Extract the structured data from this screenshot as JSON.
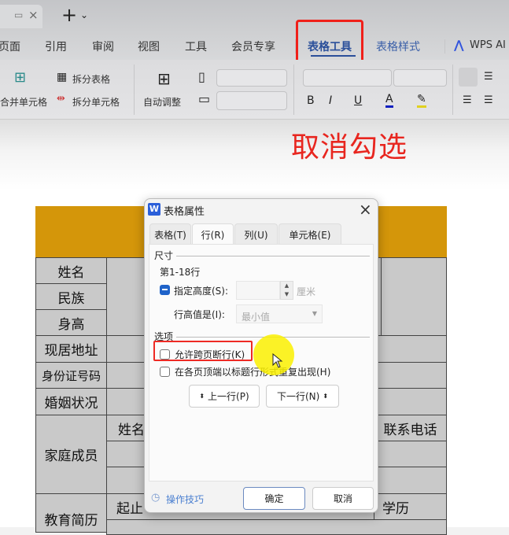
{
  "tabbar": {
    "new_tab": "+",
    "dropdown": "⌄"
  },
  "menu": {
    "items": [
      "页面",
      "引用",
      "审阅",
      "视图",
      "工具",
      "会员专享",
      "表格工具",
      "表格样式",
      "WPS AI"
    ],
    "active": "表格工具"
  },
  "ribbon": {
    "merge_cells": "合并单元格",
    "split_table": "拆分表格",
    "split_cells": "拆分单元格",
    "auto_fit": "自动调整",
    "bold": "B",
    "italic": "I",
    "underline": "U",
    "font_color": "A"
  },
  "annotation": {
    "text": "取消勾选",
    "color": "#e8261f"
  },
  "table": {
    "header_color": "#d4960a",
    "labels": [
      "姓名",
      "民族",
      "身高",
      "现居地址",
      "身份证号码",
      "婚姻状况",
      "家庭成员",
      "教育简历"
    ],
    "sub_headers": {
      "member_name": "姓名",
      "phone": "联系电话",
      "period": "起止",
      "education": "学历"
    }
  },
  "dialog": {
    "title": "表格属性",
    "close": "×",
    "tabs": [
      "表格(T)",
      "行(R)",
      "列(U)",
      "单元格(E)"
    ],
    "active_tab": "行(R)",
    "size_section": "尺寸",
    "rows": "第1-18行",
    "specify_height": {
      "label": "指定高度(S):",
      "value": "",
      "unit": "厘米",
      "state": "indeterminate"
    },
    "row_height_is": {
      "label": "行高值是(I):",
      "value": "最小值"
    },
    "options_section": "选项",
    "allow_break": {
      "label": "允许跨页断行(K)",
      "checked": false
    },
    "repeat_header": {
      "label": "在各页顶端以标题行形式重复出现(H)",
      "checked": false
    },
    "prev_row": "上一行(P)",
    "next_row": "下一行(N)",
    "tips": "操作技巧",
    "ok": "确定",
    "cancel": "取消"
  }
}
